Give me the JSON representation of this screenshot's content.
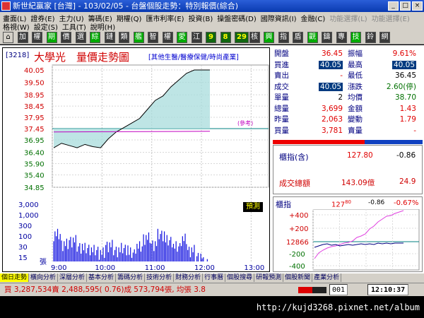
{
  "window": {
    "title": "新世紀贏家 [台灣] - 103/02/05 - 台盤個股走勢：特別報價(綜合)",
    "buttons": [
      "_",
      "□",
      "×"
    ]
  },
  "menu": {
    "row1": [
      "畫面(L)",
      "證券(E)",
      "主力(U)",
      "籌碼(E)",
      "期權(Q)",
      "匯市利率(E)",
      "投資(B)",
      "操盤密碼(D)",
      "國際資訊(I)",
      "金融(C)",
      "功能選擇(L)",
      "功能選擇(E)"
    ],
    "row2": [
      "格視(W)",
      "設定(S)",
      "工具(T)",
      "說明(H)"
    ]
  },
  "toolbar": {
    "items": [
      "⌂",
      "加",
      "權",
      "期",
      "價",
      "選",
      "綜",
      "鏈",
      "類",
      "艦",
      "智",
      "權",
      "愛",
      "江",
      "9",
      "8",
      "29",
      "核",
      "興",
      "指",
      "盾",
      "觀",
      "鑄",
      "專",
      "技",
      "鈴",
      "網"
    ]
  },
  "header": {
    "code": "[3218]",
    "name": "大學光",
    "chart_title": "量價走勢圖",
    "industry": "[其他生醫/醫療保健/時尚產業]",
    "ref_label": "(參考)",
    "predict_btn": "預測"
  },
  "price_axis": [
    "40.05",
    "39.50",
    "38.95",
    "38.45",
    "37.95",
    "37.45",
    "36.95",
    "36.40",
    "35.90",
    "35.40",
    "34.85"
  ],
  "vol_axis": [
    "3,000",
    "1,000",
    "300",
    "100",
    "30",
    "15"
  ],
  "vol_unit": "張",
  "time_axis": [
    "9:00",
    "10:00",
    "11:00",
    "12:00",
    "13:00"
  ],
  "stats": {
    "open_label": "開盤",
    "open": "36.45",
    "amp_label": "振幅",
    "amp": "9.61%",
    "bid_label": "買進",
    "bid": "40.05",
    "high_label": "最高",
    "high": "40.05",
    "ask_label": "賣出",
    "ask": "-",
    "low_label": "最低",
    "low": "36.45",
    "deal_label": "成交",
    "deal": "40.05",
    "chg_label": "漲跌",
    "chg": "2.60(停)",
    "single_label": "單量",
    "single": "2",
    "avg_label": "均價",
    "avg": "38.70",
    "total_label": "總量",
    "total": "3,699",
    "amount_label": "金額",
    "amount": "1.43",
    "yest_label": "昨量",
    "yest": "2,063",
    "vary_label": "變動",
    "vary": "1.79",
    "buyvol_label": "買量",
    "buyvol": "3,781",
    "sellvol_label": "賣量",
    "sellvol": "-"
  },
  "index_box": {
    "label": "櫃指(含)",
    "value": "127.80",
    "change": "-0.86",
    "turnover_label": "成交總額",
    "turnover": "143.09億",
    "turnover_chg": "24.9"
  },
  "mini_chart": {
    "label": "櫃指",
    "value_int": "127",
    "value_dec": "80",
    "change": "-0.86",
    "pct": "-0.67%",
    "axis": [
      "+400",
      "+200",
      "12866",
      "-200",
      "-400"
    ]
  },
  "tabs": [
    "個日走勢",
    "橫向分析",
    "深層分析",
    "基本分析",
    "籌碼分析",
    "技術分析",
    "財務分析",
    "行事曆",
    "個股搜尋",
    "研報預測",
    "個股新聞",
    "產業分析"
  ],
  "status": {
    "text": "買 3,287,534賣 2,488,595( 0.76)成 573,794張, 均張 3.8",
    "code": "001",
    "time": "12:10:37"
  },
  "url": "http://kujd3268.pixnet.net/album",
  "chart_data": {
    "type": "line",
    "title": "量價走勢圖",
    "x": [
      "9:00",
      "9:10",
      "9:20",
      "9:30",
      "9:40",
      "9:50",
      "10:00",
      "10:10",
      "10:20",
      "10:30",
      "10:40",
      "10:50",
      "11:00",
      "11:10",
      "11:20",
      "11:30",
      "11:40",
      "11:50",
      "12:00",
      "12:05",
      "12:10"
    ],
    "series": [
      {
        "values": [
          36.6,
          36.8,
          36.7,
          36.6,
          36.75,
          36.65,
          36.6,
          37.0,
          37.3,
          37.5,
          37.7,
          37.9,
          38.3,
          38.7,
          38.9,
          39.3,
          39.6,
          39.9,
          40.05,
          40.05,
          40.05
        ]
      }
    ],
    "ref_price": 37.45,
    "ylim": [
      34.85,
      40.05
    ],
    "volume": {
      "values": [
        120,
        40,
        60,
        30,
        25,
        20,
        15,
        35,
        20,
        25,
        15,
        30,
        80,
        40,
        120,
        60,
        30,
        70,
        20,
        10,
        5
      ]
    },
    "colors": {
      "price": "#000000",
      "fill": "#a8dcdc",
      "avg": "#c000c0",
      "volume": "#1010e0",
      "ref": "#008080"
    }
  }
}
